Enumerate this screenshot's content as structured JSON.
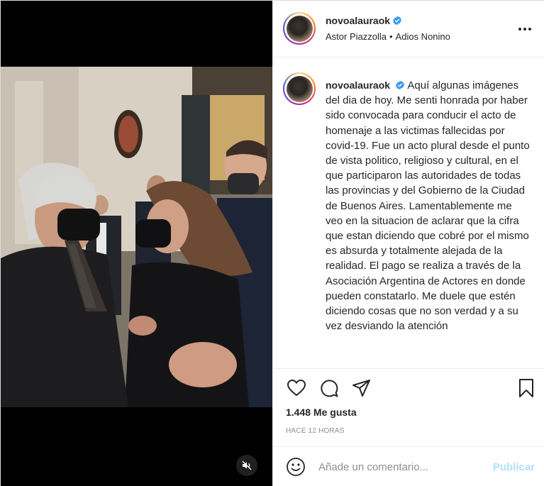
{
  "header": {
    "username": "novoalauraok",
    "audio_artist": "Astor Piazzolla",
    "separator": "•",
    "audio_title": "Adios Nonino"
  },
  "caption": {
    "username": "novoalauraok",
    "text": "Aquí algunas imágenes del dia de hoy. Me senti honrada por haber sido convocada para conducir el acto de homenaje a las victimas fallecidas por covid-19. Fue un acto plural desde el punto de vista politico, religioso y cultural, en el que participaron las autoridades de todas las provincias y del Gobierno de la Ciudad de Buenos Aires. Lamentablemente me veo en la situacion de aclarar que la cifra que estan diciendo que cobré por el mismo es absurda y totalmente alejada de la realidad. El pago se realiza a través de la Asociación Argentina de Actores en donde pueden constatarlo. Me duele que estén diciendo cosas que no son verdad y a su vez desviando la atención"
  },
  "stats": {
    "likes": "1.448 Me gusta",
    "time_ago": "HACE 12 HORAS"
  },
  "comment": {
    "placeholder": "Añade un comentario...",
    "publish_label": "Publicar"
  },
  "icons": {
    "more": "more-options-icon",
    "like": "heart-icon",
    "comment": "comment-bubble-icon",
    "share": "paper-plane-icon",
    "save": "bookmark-icon",
    "emoji": "emoji-smiley-icon",
    "mute": "speaker-muted-icon",
    "verified": "verified-badge-icon"
  },
  "colors": {
    "verified": "#3897f0",
    "publish_disabled": "#b2dffc",
    "muted_text": "#8e8e8e",
    "text": "#262626"
  }
}
